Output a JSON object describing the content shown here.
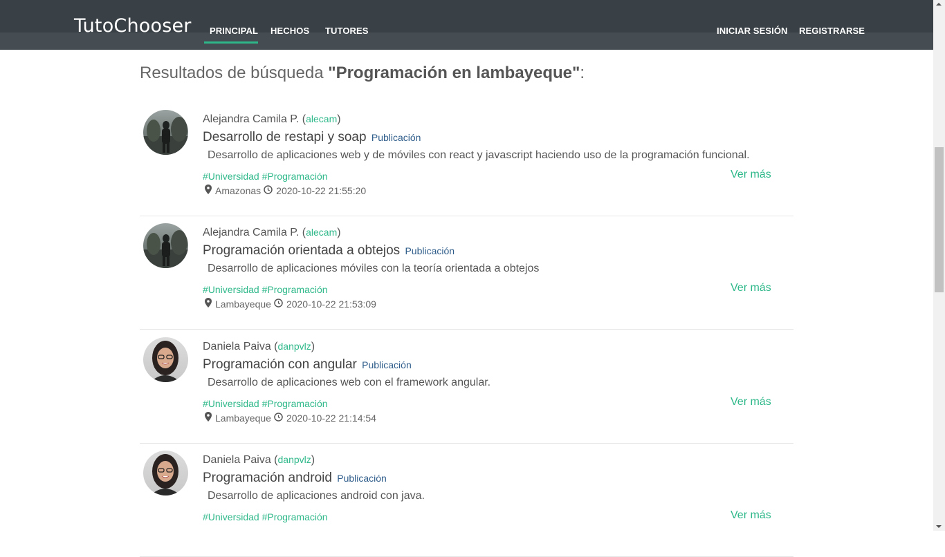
{
  "navbar": {
    "brand": "TutoChooser",
    "links": [
      {
        "label": "PRINCIPAL",
        "active": true
      },
      {
        "label": "HECHOS"
      },
      {
        "label": "TUTORES"
      }
    ],
    "right_links": [
      {
        "label": "INICIAR SESIÓN"
      },
      {
        "label": "REGISTRARSE"
      }
    ],
    "accent_color": "#2eb88a",
    "background_color": "#454d52"
  },
  "search": {
    "prefix": "Resultados de búsqueda ",
    "query": "\"Programación en lambayeque\"",
    "suffix": ":"
  },
  "results": [
    {
      "author": "Alejandra Camila P.",
      "username": "alecam",
      "title": "Desarrollo de restapi y soap",
      "type": "Publicación",
      "description": "Desarrollo de aplicaciones web y de móviles con react y javascript haciendo uso de la programación funcional.",
      "tags": [
        "#Universidad",
        "#Programación"
      ],
      "location": "Amazonas",
      "datetime": "2020-10-22 21:55:20",
      "action": "Ver más",
      "avatar_kind": "outdoor"
    },
    {
      "author": "Alejandra Camila P.",
      "username": "alecam",
      "title": "Programación orientada a obtejos",
      "type": "Publicación",
      "description": "Desarrollo de aplicaciones móviles con la teoría orientada a obtejos",
      "tags": [
        "#Universidad",
        "#Programación"
      ],
      "location": "Lambayeque",
      "datetime": "2020-10-22 21:53:09",
      "action": "Ver más",
      "avatar_kind": "outdoor"
    },
    {
      "author": "Daniela Paiva",
      "username": "danpvlz",
      "title": "Programación con angular",
      "type": "Publicación",
      "description": "Desarrollo de aplicaciones web con el framework angular.",
      "tags": [
        "#Universidad",
        "#Programación"
      ],
      "location": "Lambayeque",
      "datetime": "2020-10-22 21:14:54",
      "action": "Ver más",
      "avatar_kind": "portrait"
    },
    {
      "author": "Daniela Paiva",
      "username": "danpvlz",
      "title": "Programación android",
      "type": "Publicación",
      "description": "Desarrollo de aplicaciones android con java.",
      "tags": [
        "#Universidad",
        "#Programación"
      ],
      "location": "",
      "datetime": "",
      "action": "Ver más",
      "avatar_kind": "portrait"
    }
  ]
}
